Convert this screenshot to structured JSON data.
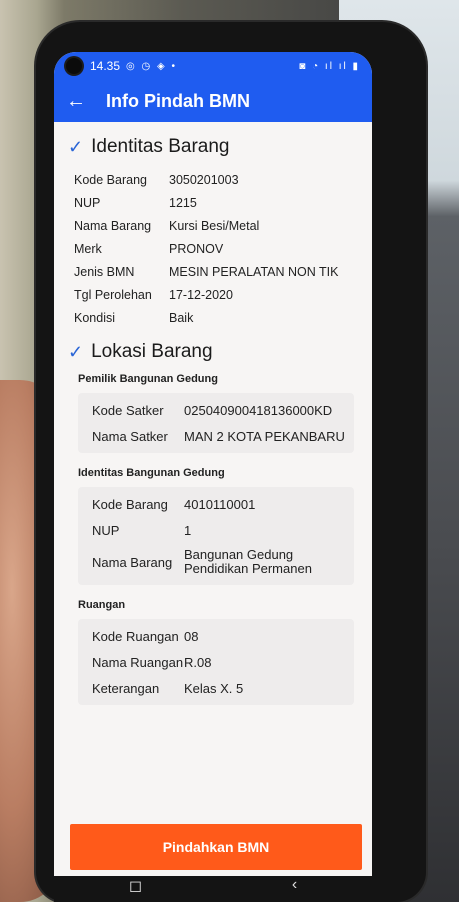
{
  "status_bar": {
    "time": "14.35",
    "left_icons": "◎ ◷ ◈ •",
    "right_icons": "◙ ◔ ıl ıl ▮"
  },
  "app_bar": {
    "title": "Info Pindah BMN"
  },
  "identitas_barang": {
    "title": "Identitas Barang",
    "rows": [
      {
        "label": "Kode Barang",
        "value": "3050201003"
      },
      {
        "label": "NUP",
        "value": "1215"
      },
      {
        "label": "Nama Barang",
        "value": "Kursi Besi/Metal"
      },
      {
        "label": "Merk",
        "value": "PRONOV"
      },
      {
        "label": "Jenis BMN",
        "value": "MESIN PERALATAN NON TIK"
      },
      {
        "label": "Tgl Perolehan",
        "value": "17-12-2020"
      },
      {
        "label": "Kondisi",
        "value": "Baik"
      }
    ]
  },
  "lokasi_barang": {
    "title": "Lokasi Barang",
    "pemilik": {
      "title": "Pemilik Bangunan Gedung",
      "rows": [
        {
          "label": "Kode Satker",
          "value": "025040900418136000KD"
        },
        {
          "label": "Nama Satker",
          "value": "MAN 2 KOTA PEKANBARU"
        }
      ]
    },
    "identitas_bangunan": {
      "title": "Identitas Bangunan Gedung",
      "rows": [
        {
          "label": "Kode Barang",
          "value": "4010110001"
        },
        {
          "label": "NUP",
          "value": "1"
        },
        {
          "label": "Nama Barang",
          "value": "Bangunan Gedung Pendidikan Permanen"
        }
      ]
    },
    "ruangan": {
      "title": "Ruangan",
      "rows": [
        {
          "label": "Kode Ruangan",
          "value": "08"
        },
        {
          "label": "Nama Ruangan",
          "value": "R.08"
        },
        {
          "label": "Keterangan",
          "value": "Kelas X. 5"
        }
      ]
    }
  },
  "action_button": {
    "label": "Pindahkan BMN"
  },
  "nav_bar": {
    "home": "◻",
    "back": "‹"
  },
  "colors": {
    "primary": "#1f5cf0",
    "accent": "#ff5a1a",
    "check": "#2a65d6"
  },
  "icons": [
    "back-arrow-icon",
    "check-icon",
    "camera-icon",
    "wifi-icon",
    "signal-icon",
    "battery-icon"
  ]
}
